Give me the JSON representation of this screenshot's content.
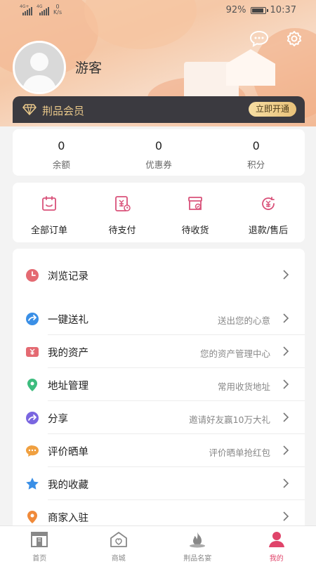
{
  "status_bar": {
    "signal_1": "4G+",
    "signal_2": "4G",
    "net_speed_value": "0",
    "net_speed_unit": "K/s",
    "battery_percent": "92%",
    "battery_level": 0.92,
    "time": "10:37"
  },
  "profile": {
    "username": "游客",
    "avatar_icon": "default-avatar-icon"
  },
  "header_icons": [
    {
      "name": "message-icon"
    },
    {
      "name": "settings-gear-icon"
    }
  ],
  "vip": {
    "title": "荆品会员",
    "button_label": "立即开通",
    "icon": "diamond-icon"
  },
  "stats": [
    {
      "value": "0",
      "label": "余额"
    },
    {
      "value": "0",
      "label": "优惠券"
    },
    {
      "value": "0",
      "label": "积分"
    }
  ],
  "orders": [
    {
      "label": "全部订单",
      "icon": "all-orders-icon"
    },
    {
      "label": "待支付",
      "icon": "pending-payment-icon"
    },
    {
      "label": "待收货",
      "icon": "pending-delivery-icon"
    },
    {
      "label": "退款/售后",
      "icon": "refund-icon"
    }
  ],
  "menu": [
    {
      "label": "浏览记录",
      "desc": "",
      "icon": "history-clock-icon",
      "color": "#e46a72"
    },
    {
      "label": "一键送礼",
      "desc": "送出您的心意",
      "icon": "gift-send-icon",
      "color": "#3a8fe6"
    },
    {
      "label": "我的资产",
      "desc": "您的资产管理中心",
      "icon": "assets-wallet-icon",
      "color": "#e46a72"
    },
    {
      "label": "地址管理",
      "desc": "常用收货地址",
      "icon": "location-pin-icon",
      "color": "#3dbc7e"
    },
    {
      "label": "分享",
      "desc": "邀请好友赢10万大礼",
      "icon": "share-icon",
      "color": "#7a66e0"
    },
    {
      "label": "评价晒单",
      "desc": "评价晒单抢红包",
      "icon": "review-comment-icon",
      "color": "#f0a040"
    },
    {
      "label": "我的收藏",
      "desc": "",
      "icon": "favorite-star-icon",
      "color": "#3a8fe6"
    },
    {
      "label": "商家入驻",
      "desc": "",
      "icon": "merchant-join-icon",
      "color": "#f08a3a"
    }
  ],
  "tabbar": [
    {
      "label": "首页",
      "icon": "home-icon",
      "active": false
    },
    {
      "label": "商城",
      "icon": "mall-icon",
      "active": false
    },
    {
      "label": "荆品名宴",
      "icon": "banquet-flame-icon",
      "active": false
    },
    {
      "label": "我的",
      "icon": "my-profile-icon",
      "active": true
    }
  ],
  "colors": {
    "accent": "#e0446a",
    "vip_gold": "#e9c88a",
    "vip_bg": "#3b3a40",
    "order_icon": "#d9527a"
  }
}
